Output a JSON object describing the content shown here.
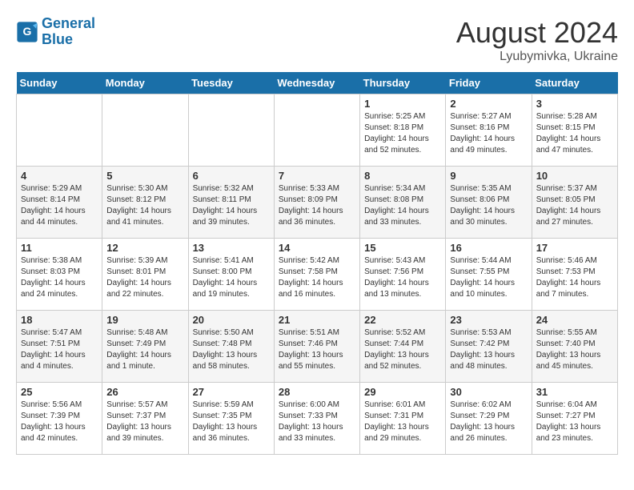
{
  "header": {
    "logo_line1": "General",
    "logo_line2": "Blue",
    "month_year": "August 2024",
    "location": "Lyubymivka, Ukraine"
  },
  "weekdays": [
    "Sunday",
    "Monday",
    "Tuesday",
    "Wednesday",
    "Thursday",
    "Friday",
    "Saturday"
  ],
  "weeks": [
    [
      {
        "day": "",
        "info": ""
      },
      {
        "day": "",
        "info": ""
      },
      {
        "day": "",
        "info": ""
      },
      {
        "day": "",
        "info": ""
      },
      {
        "day": "1",
        "info": "Sunrise: 5:25 AM\nSunset: 8:18 PM\nDaylight: 14 hours\nand 52 minutes."
      },
      {
        "day": "2",
        "info": "Sunrise: 5:27 AM\nSunset: 8:16 PM\nDaylight: 14 hours\nand 49 minutes."
      },
      {
        "day": "3",
        "info": "Sunrise: 5:28 AM\nSunset: 8:15 PM\nDaylight: 14 hours\nand 47 minutes."
      }
    ],
    [
      {
        "day": "4",
        "info": "Sunrise: 5:29 AM\nSunset: 8:14 PM\nDaylight: 14 hours\nand 44 minutes."
      },
      {
        "day": "5",
        "info": "Sunrise: 5:30 AM\nSunset: 8:12 PM\nDaylight: 14 hours\nand 41 minutes."
      },
      {
        "day": "6",
        "info": "Sunrise: 5:32 AM\nSunset: 8:11 PM\nDaylight: 14 hours\nand 39 minutes."
      },
      {
        "day": "7",
        "info": "Sunrise: 5:33 AM\nSunset: 8:09 PM\nDaylight: 14 hours\nand 36 minutes."
      },
      {
        "day": "8",
        "info": "Sunrise: 5:34 AM\nSunset: 8:08 PM\nDaylight: 14 hours\nand 33 minutes."
      },
      {
        "day": "9",
        "info": "Sunrise: 5:35 AM\nSunset: 8:06 PM\nDaylight: 14 hours\nand 30 minutes."
      },
      {
        "day": "10",
        "info": "Sunrise: 5:37 AM\nSunset: 8:05 PM\nDaylight: 14 hours\nand 27 minutes."
      }
    ],
    [
      {
        "day": "11",
        "info": "Sunrise: 5:38 AM\nSunset: 8:03 PM\nDaylight: 14 hours\nand 24 minutes."
      },
      {
        "day": "12",
        "info": "Sunrise: 5:39 AM\nSunset: 8:01 PM\nDaylight: 14 hours\nand 22 minutes."
      },
      {
        "day": "13",
        "info": "Sunrise: 5:41 AM\nSunset: 8:00 PM\nDaylight: 14 hours\nand 19 minutes."
      },
      {
        "day": "14",
        "info": "Sunrise: 5:42 AM\nSunset: 7:58 PM\nDaylight: 14 hours\nand 16 minutes."
      },
      {
        "day": "15",
        "info": "Sunrise: 5:43 AM\nSunset: 7:56 PM\nDaylight: 14 hours\nand 13 minutes."
      },
      {
        "day": "16",
        "info": "Sunrise: 5:44 AM\nSunset: 7:55 PM\nDaylight: 14 hours\nand 10 minutes."
      },
      {
        "day": "17",
        "info": "Sunrise: 5:46 AM\nSunset: 7:53 PM\nDaylight: 14 hours\nand 7 minutes."
      }
    ],
    [
      {
        "day": "18",
        "info": "Sunrise: 5:47 AM\nSunset: 7:51 PM\nDaylight: 14 hours\nand 4 minutes."
      },
      {
        "day": "19",
        "info": "Sunrise: 5:48 AM\nSunset: 7:49 PM\nDaylight: 14 hours\nand 1 minute."
      },
      {
        "day": "20",
        "info": "Sunrise: 5:50 AM\nSunset: 7:48 PM\nDaylight: 13 hours\nand 58 minutes."
      },
      {
        "day": "21",
        "info": "Sunrise: 5:51 AM\nSunset: 7:46 PM\nDaylight: 13 hours\nand 55 minutes."
      },
      {
        "day": "22",
        "info": "Sunrise: 5:52 AM\nSunset: 7:44 PM\nDaylight: 13 hours\nand 52 minutes."
      },
      {
        "day": "23",
        "info": "Sunrise: 5:53 AM\nSunset: 7:42 PM\nDaylight: 13 hours\nand 48 minutes."
      },
      {
        "day": "24",
        "info": "Sunrise: 5:55 AM\nSunset: 7:40 PM\nDaylight: 13 hours\nand 45 minutes."
      }
    ],
    [
      {
        "day": "25",
        "info": "Sunrise: 5:56 AM\nSunset: 7:39 PM\nDaylight: 13 hours\nand 42 minutes."
      },
      {
        "day": "26",
        "info": "Sunrise: 5:57 AM\nSunset: 7:37 PM\nDaylight: 13 hours\nand 39 minutes."
      },
      {
        "day": "27",
        "info": "Sunrise: 5:59 AM\nSunset: 7:35 PM\nDaylight: 13 hours\nand 36 minutes."
      },
      {
        "day": "28",
        "info": "Sunrise: 6:00 AM\nSunset: 7:33 PM\nDaylight: 13 hours\nand 33 minutes."
      },
      {
        "day": "29",
        "info": "Sunrise: 6:01 AM\nSunset: 7:31 PM\nDaylight: 13 hours\nand 29 minutes."
      },
      {
        "day": "30",
        "info": "Sunrise: 6:02 AM\nSunset: 7:29 PM\nDaylight: 13 hours\nand 26 minutes."
      },
      {
        "day": "31",
        "info": "Sunrise: 6:04 AM\nSunset: 7:27 PM\nDaylight: 13 hours\nand 23 minutes."
      }
    ]
  ]
}
